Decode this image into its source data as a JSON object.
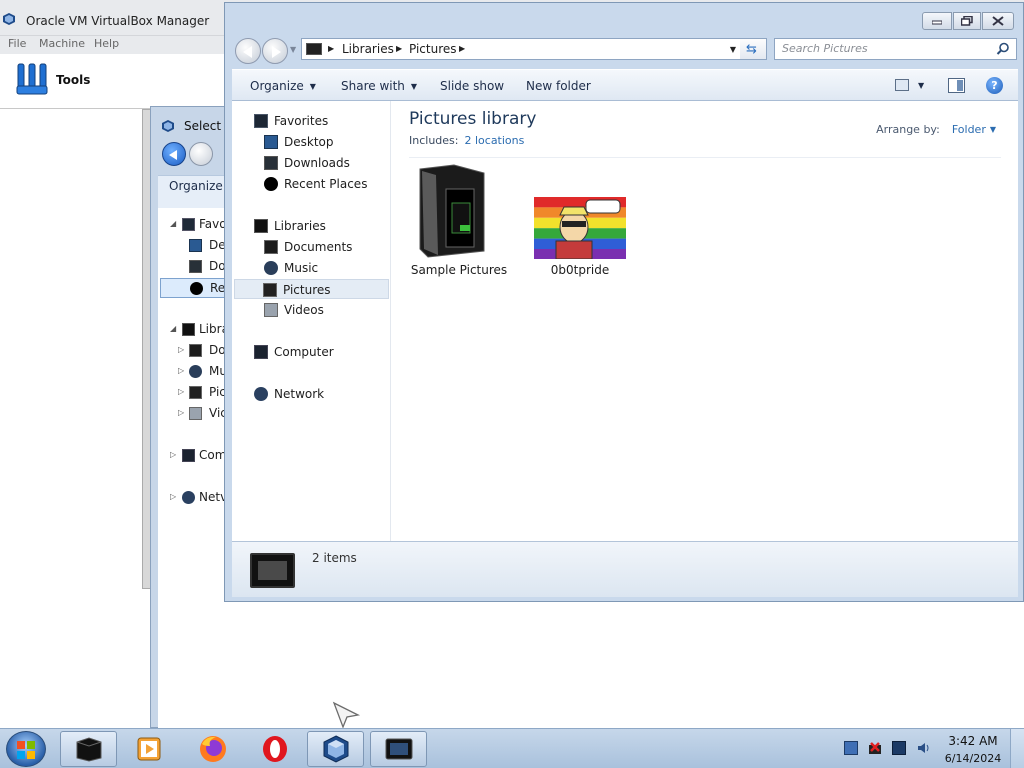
{
  "vbox": {
    "title": "Oracle VM VirtualBox Manager",
    "menu": [
      "File",
      "Machine",
      "Help"
    ],
    "tools_label": "Tools"
  },
  "bg_dialog": {
    "title": "Select F",
    "organize": "Organize",
    "tree": [
      {
        "label": "Favo",
        "icon": "star-icon"
      },
      {
        "label": "De",
        "icon": "desktop-icon"
      },
      {
        "label": "Do",
        "icon": "downloads-icon"
      },
      {
        "label": "Re",
        "icon": "recent-places-icon"
      },
      {
        "label": "Libra",
        "icon": "libraries-icon"
      },
      {
        "label": "Do",
        "icon": "documents-icon"
      },
      {
        "label": "Mu",
        "icon": "music-icon"
      },
      {
        "label": "Pic",
        "icon": "pictures-icon"
      },
      {
        "label": "Vic",
        "icon": "videos-icon"
      },
      {
        "label": "Com",
        "icon": "computer-icon"
      },
      {
        "label": "Netv",
        "icon": "network-icon"
      }
    ]
  },
  "explorer": {
    "breadcrumbs": [
      "Libraries",
      "Pictures"
    ],
    "search_placeholder": "Search Pictures",
    "commands": {
      "organize": "Organize",
      "share_with": "Share with",
      "slide_show": "Slide show",
      "new_folder": "New folder"
    },
    "nav": {
      "favorites": "Favorites",
      "desktop": "Desktop",
      "downloads": "Downloads",
      "recent_places": "Recent Places",
      "libraries": "Libraries",
      "documents": "Documents",
      "music": "Music",
      "pictures": "Pictures",
      "videos": "Videos",
      "computer": "Computer",
      "network": "Network"
    },
    "library_title": "Pictures library",
    "includes_label": "Includes:",
    "includes_link": "2 locations",
    "arrange_label": "Arrange by:",
    "arrange_value": "Folder",
    "items": [
      {
        "name": "Sample Pictures",
        "kind": "folder"
      },
      {
        "name": "0b0tpride",
        "kind": "image"
      }
    ],
    "status_count": "2 items"
  },
  "taskbar": {
    "apps": [
      "explorer-icon",
      "media-player-icon",
      "firefox-icon",
      "opera-icon",
      "virtualbox-icon",
      "virtualbox-vm-icon"
    ],
    "time": "3:42 AM",
    "date": "6/14/2024"
  },
  "colors": {
    "accent": "#2b6cb0",
    "title_text": "#1e395b",
    "taskbar": "#b7cbe2",
    "window_frame": "#c9d9ec"
  }
}
